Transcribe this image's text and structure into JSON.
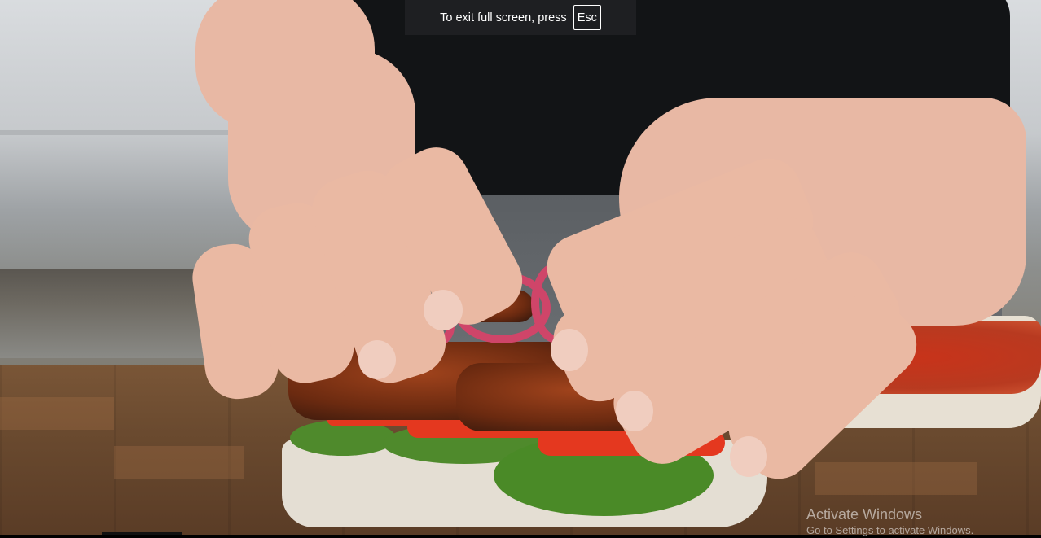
{
  "fullscreen_notice": {
    "text": "To exit full screen, press",
    "key": "Esc"
  },
  "watermark": {
    "title": "Activate Windows",
    "subtitle": "Go to Settings to activate Windows."
  },
  "video": {
    "icon": "video-frame-icon"
  },
  "colors": {
    "notice_bg": "#202124",
    "notice_text": "#ffffff",
    "watermark_text": "#ffffff"
  }
}
